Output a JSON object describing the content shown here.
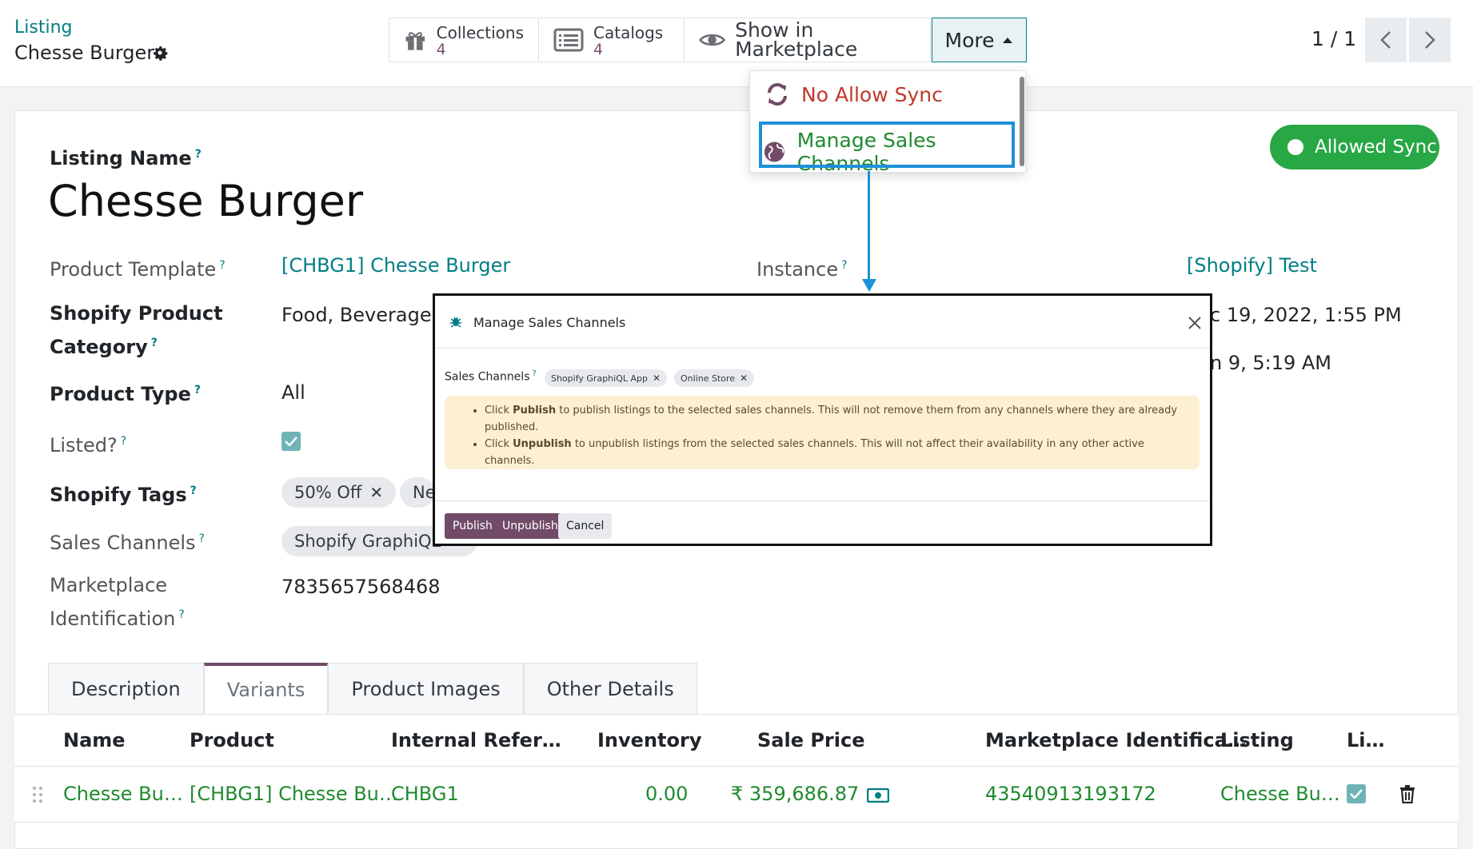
{
  "breadcrumb": {
    "parent": "Listing",
    "current": "Chesse Burger"
  },
  "smart_buttons": {
    "collections": {
      "label": "Collections",
      "count": "4"
    },
    "catalogs": {
      "label": "Catalogs",
      "count": "4"
    },
    "show_marketplace": {
      "label": "Show in Marketplace"
    },
    "more": {
      "label": "More"
    }
  },
  "pager": {
    "value": "1 / 1"
  },
  "dropdown": {
    "items": [
      {
        "label": "No Allow Sync"
      },
      {
        "label": "Manage Sales Channels"
      }
    ]
  },
  "sync_button": {
    "label": "Allowed Sync"
  },
  "form": {
    "listing_name_label": "Listing Name",
    "listing_name": "Chesse Burger",
    "product_template_label": "Product Template",
    "product_template": "[CHBG1] Chesse Burger",
    "instance_label": "Instance",
    "instance": "[Shopify] Test",
    "category_label_1": "Shopify Product",
    "category_label_2": "Category",
    "category": "Food, Beverages",
    "date_1": "c 19, 2022, 1:55 PM",
    "date_2": "n 9, 5:19 AM",
    "product_type_label": "Product Type",
    "product_type": "All",
    "listed_label": "Listed?",
    "tags_label": "Shopify Tags",
    "tags": [
      "50% Off",
      "Ne"
    ],
    "sales_channels_label": "Sales Channels",
    "sales_channel_tag": "Shopify GraphiQL",
    "marketplace_id_label_1": "Marketplace",
    "marketplace_id_label_2": "Identification",
    "marketplace_id": "7835657568468",
    "help_mark": "?"
  },
  "tabs": [
    "Description",
    "Variants",
    "Product Images",
    "Other Details"
  ],
  "table": {
    "headers": [
      "Name",
      "Product",
      "Internal Refer…",
      "Inventory",
      "Sale Price",
      "Marketplace Identifica…",
      "Listing",
      "Li…"
    ],
    "row": {
      "name": "Chesse Bu…",
      "product": "[CHBG1] Chesse Bu…",
      "internal_ref": "CHBG1",
      "inventory": "0.00",
      "sale_price": "₹ 359,686.87",
      "marketplace_id": "43540913193172",
      "listing": "Chesse Bu…"
    }
  },
  "modal": {
    "title": "Manage Sales Channels",
    "field_label": "Sales Channels",
    "help_mark": "?",
    "tags": [
      "Shopify GraphiQL App",
      "Online Store"
    ],
    "alert_1_pre": "Click ",
    "alert_1_bold": "Publish",
    "alert_1_post": " to publish listings to the selected sales channels. This will not remove them from any channels where they are already published.",
    "alert_2_pre": "Click ",
    "alert_2_bold": "Unpublish",
    "alert_2_post": " to unpublish listings from the selected sales channels. This will not affect their availability in any other active channels.",
    "publish": "Publish",
    "unpublish": "Unpublish",
    "cancel": "Cancel"
  },
  "colors": {
    "accent": "#714b67",
    "link": "#017e84",
    "success": "#28a745",
    "highlight": "#1e90d8",
    "alert_bg": "#fcefd2"
  }
}
